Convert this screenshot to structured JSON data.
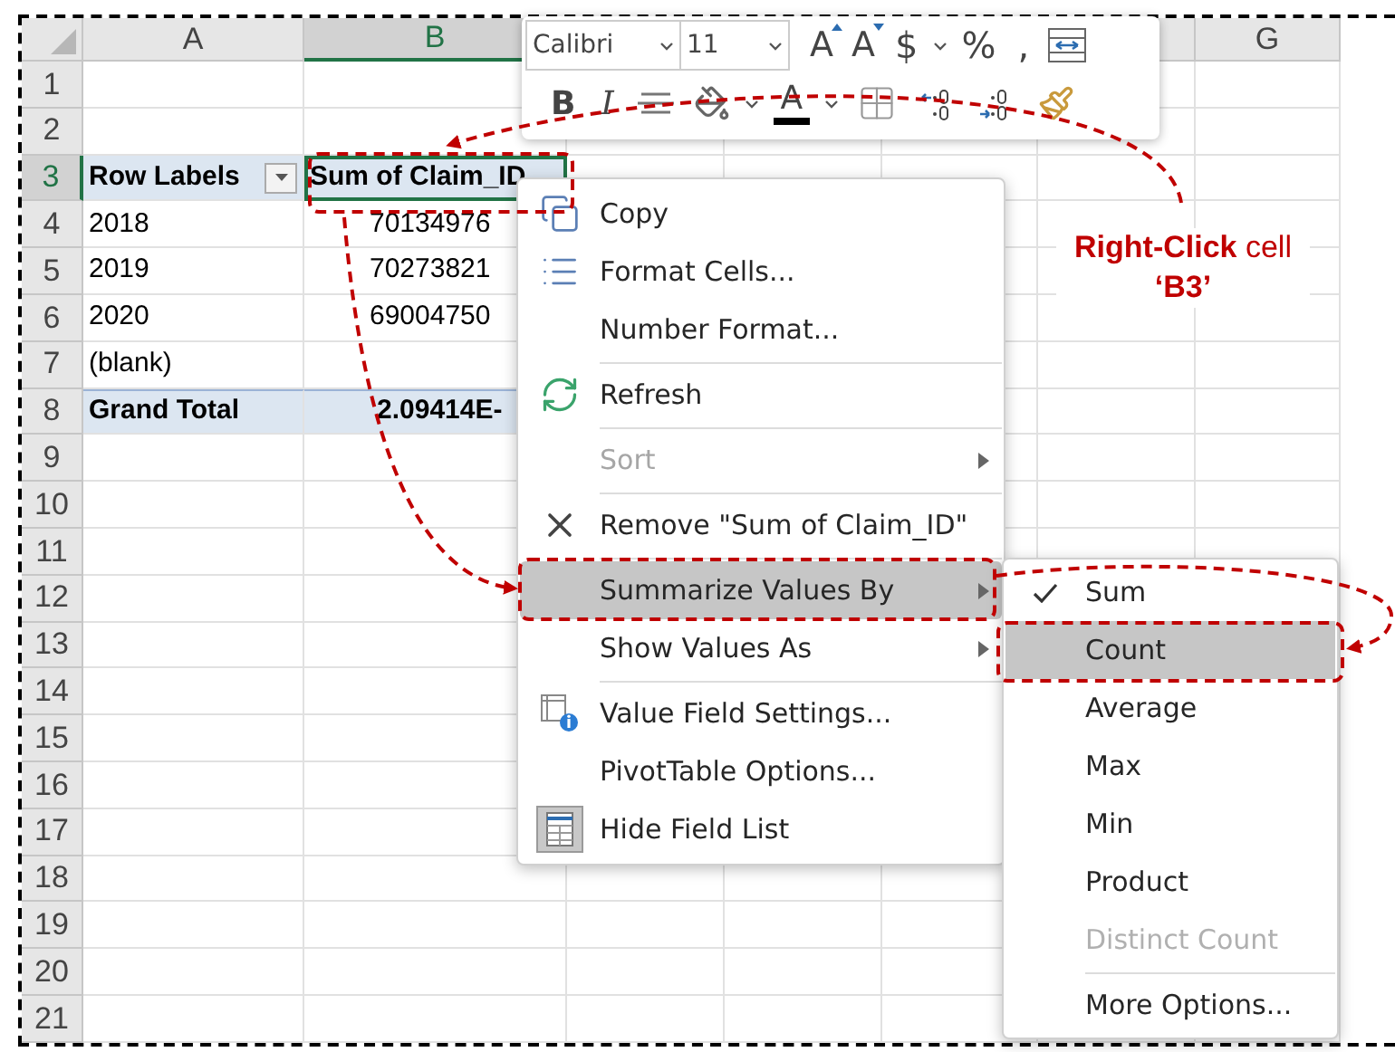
{
  "columns": [
    {
      "kind": "header",
      "label": "A",
      "selected": false
    },
    {
      "kind": "header",
      "label": "B",
      "selected": true
    },
    {
      "kind": "covered"
    },
    {
      "kind": "covered"
    },
    {
      "kind": "covered"
    },
    {
      "kind": "blank"
    },
    {
      "kind": "header",
      "label": "G",
      "selected": false
    }
  ],
  "rows": [
    {
      "number": "1",
      "selected": false,
      "cells": []
    },
    {
      "number": "2",
      "selected": false,
      "cells": []
    },
    {
      "number": "3",
      "selected": true,
      "cells": [
        {
          "kind": "heading",
          "text": "Row Labels",
          "filter": true
        },
        {
          "kind": "heading",
          "text": "Sum of Claim_ID",
          "active": true
        }
      ]
    },
    {
      "number": "4",
      "selected": false,
      "cells": [
        {
          "kind": "label",
          "text": "2018"
        },
        {
          "kind": "value",
          "text": "70134976"
        }
      ]
    },
    {
      "number": "5",
      "selected": false,
      "cells": [
        {
          "kind": "label",
          "text": "2019"
        },
        {
          "kind": "value",
          "text": "70273821"
        }
      ]
    },
    {
      "number": "6",
      "selected": false,
      "cells": [
        {
          "kind": "label",
          "text": "2020"
        },
        {
          "kind": "value",
          "text": "69004750"
        }
      ]
    },
    {
      "number": "7",
      "selected": false,
      "cells": [
        {
          "kind": "label",
          "text": "(blank)"
        }
      ]
    },
    {
      "number": "8",
      "selected": false,
      "cells": [
        {
          "kind": "total",
          "text": "Grand Total"
        },
        {
          "kind": "total",
          "text": "2.09414E-"
        }
      ]
    },
    {
      "number": "9",
      "selected": false,
      "cells": []
    },
    {
      "number": "10",
      "selected": false,
      "cells": []
    },
    {
      "number": "11",
      "selected": false,
      "cells": []
    },
    {
      "number": "12",
      "selected": false,
      "cells": []
    },
    {
      "number": "13",
      "selected": false,
      "cells": []
    },
    {
      "number": "14",
      "selected": false,
      "cells": []
    },
    {
      "number": "15",
      "selected": false,
      "cells": []
    },
    {
      "number": "16",
      "selected": false,
      "cells": []
    },
    {
      "number": "17",
      "selected": false,
      "cells": []
    },
    {
      "number": "18",
      "selected": false,
      "cells": []
    },
    {
      "number": "19",
      "selected": false,
      "cells": []
    },
    {
      "number": "20",
      "selected": false,
      "cells": []
    },
    {
      "number": "21",
      "selected": false,
      "cells": []
    }
  ],
  "mini_toolbar": {
    "font": "Calibri",
    "size": "11",
    "row_1": [
      {
        "kind": "grow",
        "glyph": "A"
      },
      {
        "kind": "shrink",
        "glyph": "A"
      },
      {
        "kind": "glyph",
        "glyph": "$"
      },
      {
        "kind": "caret"
      },
      {
        "kind": "glyph",
        "glyph": "%"
      },
      {
        "kind": "glyph",
        "glyph": ","
      },
      {
        "kind": "merge"
      }
    ],
    "row_2": [
      {
        "kind": "bold",
        "glyph": "B"
      },
      {
        "kind": "italic",
        "glyph": "I"
      },
      {
        "kind": "strike"
      },
      {
        "kind": "fill"
      },
      {
        "kind": "caret"
      },
      {
        "kind": "fontcolor",
        "glyph": "A"
      },
      {
        "kind": "caret"
      },
      {
        "kind": "borders"
      },
      {
        "kind": "decrease"
      },
      {
        "kind": "increase"
      },
      {
        "kind": "painter"
      }
    ]
  },
  "context_menu": [
    {
      "label": "Copy",
      "selected": false,
      "disabled": false,
      "submenu": false,
      "separator_after": false
    },
    {
      "label": "Format Cells...",
      "selected": false,
      "disabled": false,
      "submenu": false,
      "separator_after": false
    },
    {
      "label": "Number Format...",
      "selected": false,
      "disabled": false,
      "submenu": false,
      "separator_after": true
    },
    {
      "label": "Refresh",
      "selected": false,
      "disabled": false,
      "submenu": false,
      "separator_after": true
    },
    {
      "label": "Sort",
      "selected": false,
      "disabled": true,
      "submenu": true,
      "separator_after": true
    },
    {
      "label": "Remove \"Sum of Claim_ID\"",
      "selected": false,
      "disabled": false,
      "submenu": false,
      "separator_after": true
    },
    {
      "label": "Summarize Values By",
      "selected": true,
      "disabled": false,
      "submenu": true,
      "separator_after": false
    },
    {
      "label": "Show Values As",
      "selected": false,
      "disabled": false,
      "submenu": true,
      "separator_after": true
    },
    {
      "label": "Value Field Settings...",
      "selected": false,
      "disabled": false,
      "submenu": false,
      "separator_after": false
    },
    {
      "label": "PivotTable Options...",
      "selected": false,
      "disabled": false,
      "submenu": false,
      "separator_after": false
    },
    {
      "label": "Hide Field List",
      "selected": false,
      "disabled": false,
      "submenu": false,
      "separator_after": false
    }
  ],
  "submenu": [
    {
      "label": "Sum",
      "checked": true,
      "selected": false,
      "disabled": false,
      "separator_after": false
    },
    {
      "label": "Count",
      "checked": false,
      "selected": true,
      "disabled": false,
      "separator_after": false
    },
    {
      "label": "Average",
      "checked": false,
      "selected": false,
      "disabled": false,
      "separator_after": false
    },
    {
      "label": "Max",
      "checked": false,
      "selected": false,
      "disabled": false,
      "separator_after": false
    },
    {
      "label": "Min",
      "checked": false,
      "selected": false,
      "disabled": false,
      "separator_after": false
    },
    {
      "label": "Product",
      "checked": false,
      "selected": false,
      "disabled": false,
      "separator_after": false
    },
    {
      "label": "Distinct Count",
      "checked": false,
      "selected": false,
      "disabled": true,
      "separator_after": true
    },
    {
      "label": "More Options...",
      "checked": false,
      "selected": false,
      "disabled": false,
      "separator_after": false
    }
  ],
  "annotation": "**Right-Click** cell **‘B3’**"
}
